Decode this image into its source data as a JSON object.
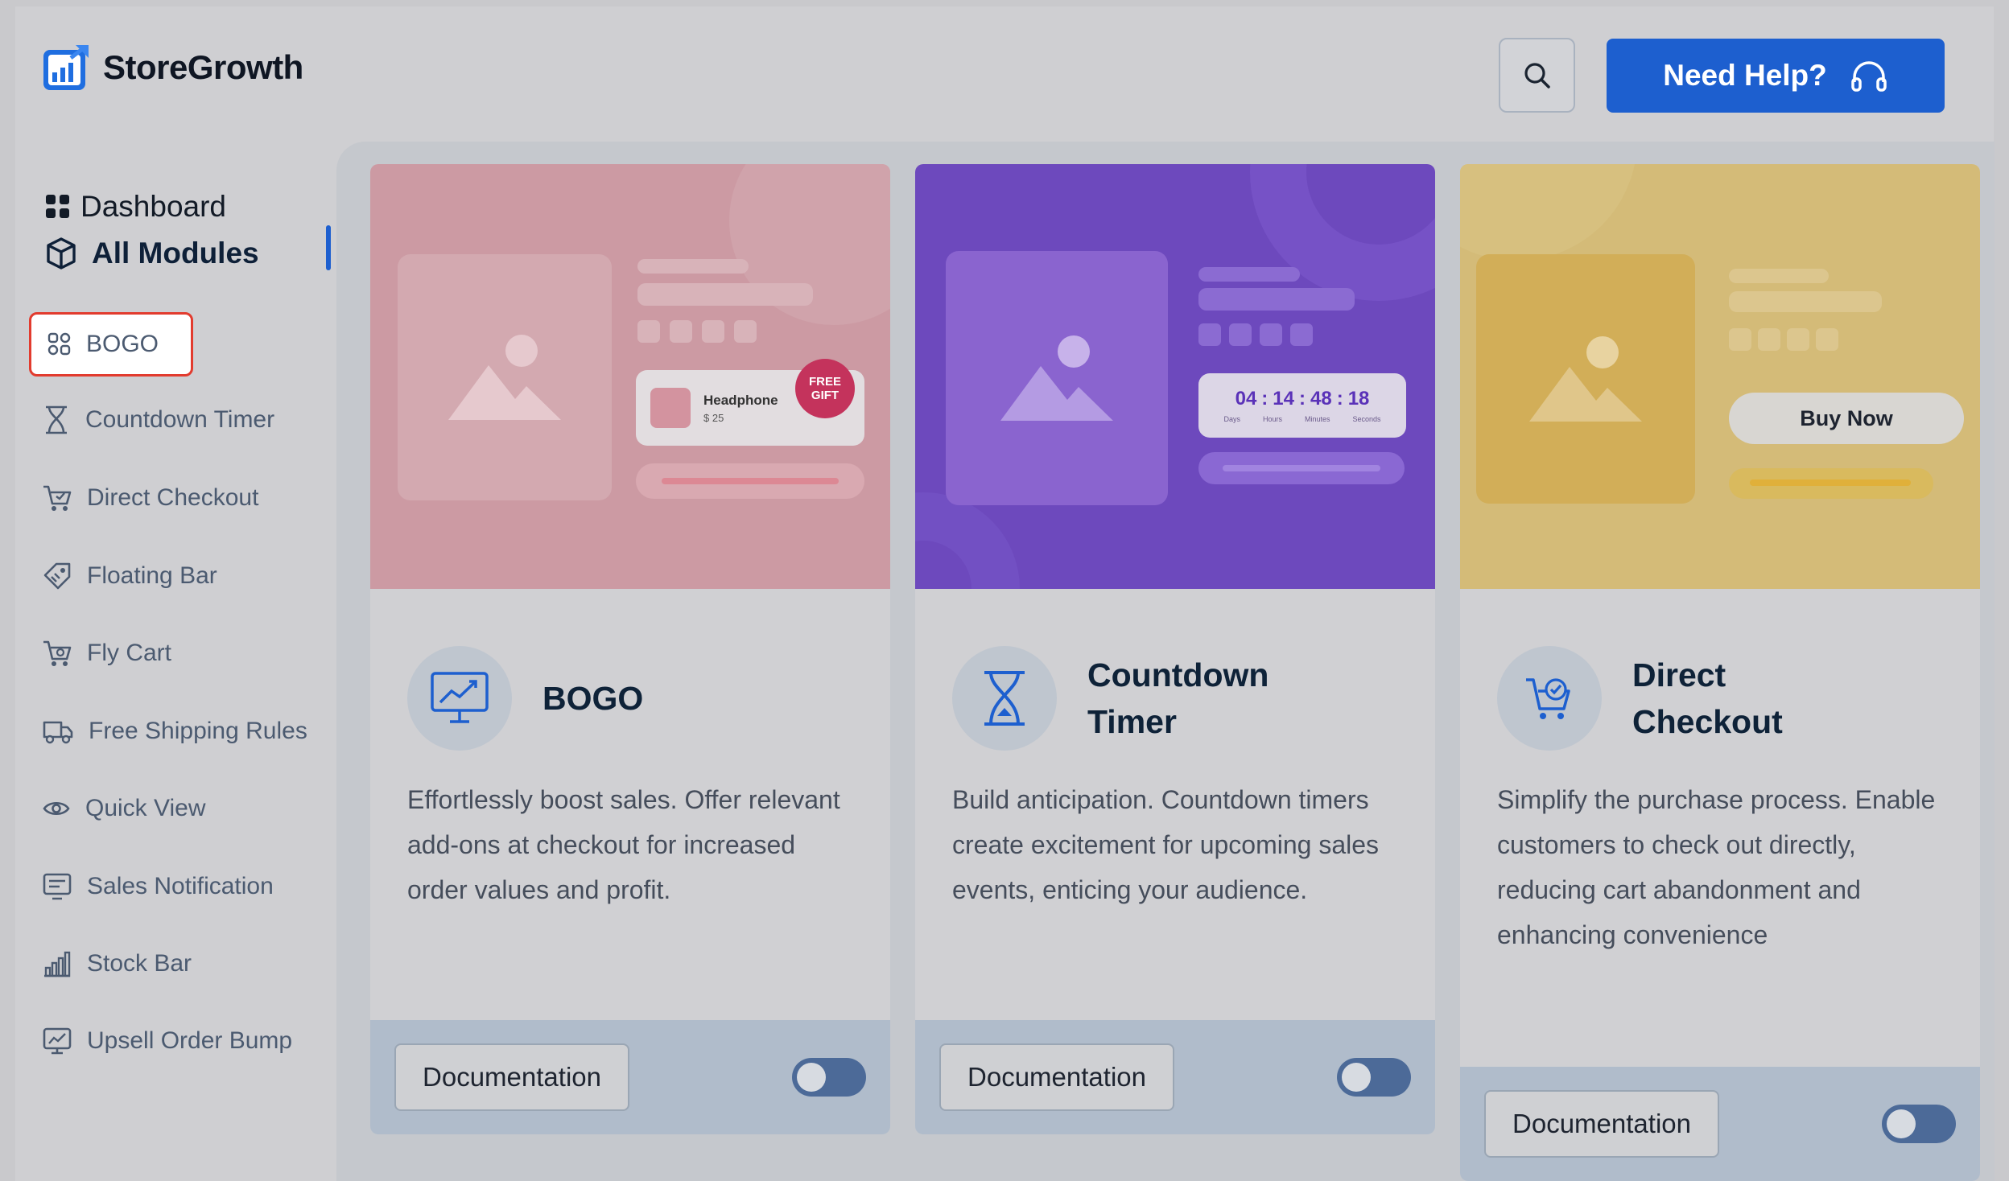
{
  "brand": {
    "name": "StoreGrowth"
  },
  "header": {
    "help_label": "Need Help?"
  },
  "nav": {
    "dashboard": "Dashboard",
    "all_modules": "All Modules"
  },
  "modules": [
    {
      "label": "BOGO",
      "icon": "bogo-icon"
    },
    {
      "label": "Countdown Timer",
      "icon": "hourglass-icon"
    },
    {
      "label": "Direct Checkout",
      "icon": "cart-check-icon"
    },
    {
      "label": "Floating Bar",
      "icon": "tag-icon"
    },
    {
      "label": "Fly Cart",
      "icon": "fly-cart-icon"
    },
    {
      "label": "Free Shipping Rules",
      "icon": "truck-icon"
    },
    {
      "label": "Quick View",
      "icon": "eye-icon"
    },
    {
      "label": "Sales Notification",
      "icon": "notification-icon"
    },
    {
      "label": "Stock Bar",
      "icon": "bar-chart-icon"
    },
    {
      "label": "Upsell Order Bump",
      "icon": "upsell-icon"
    }
  ],
  "cards": [
    {
      "title": "BOGO",
      "description": "Effortlessly boost sales. Offer relevant add-ons at checkout for increased order values and profit.",
      "doc_label": "Documentation",
      "enabled": false,
      "hero": {
        "product_name": "Headphone",
        "product_price": "$ 25",
        "badge": "FREE GIFT"
      }
    },
    {
      "title": "Countdown Timer",
      "description": "Build anticipation. Countdown timers create excitement for upcoming sales events, enticing your audience.",
      "doc_label": "Documentation",
      "enabled": false,
      "hero": {
        "days": "04",
        "hours": "14",
        "minutes": "48",
        "seconds": "18",
        "days_label": "Days",
        "hours_label": "Hours",
        "minutes_label": "Minutes",
        "seconds_label": "Seconds"
      }
    },
    {
      "title": "Direct Checkout",
      "description": "Simplify the purchase process. Enable customers to check out directly, reducing cart abandonment and enhancing convenience",
      "doc_label": "Documentation",
      "enabled": false,
      "hero": {
        "button_label": "Buy Now"
      }
    }
  ],
  "colors": {
    "accent": "#1d5fcf",
    "highlight_border": "#e23b2e"
  }
}
